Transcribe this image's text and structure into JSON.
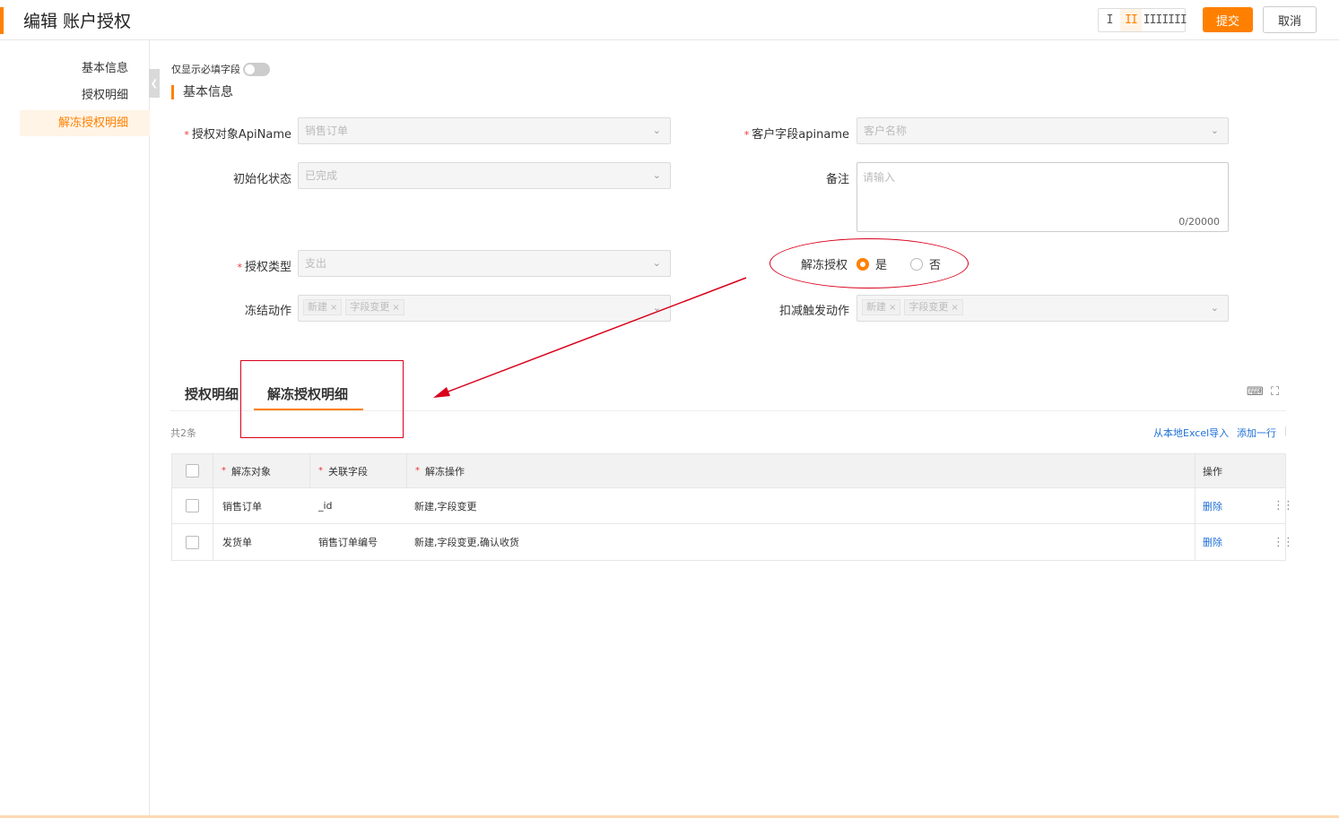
{
  "header": {
    "title": "编辑 账户授权",
    "layout_options": [
      "I",
      "II",
      "III",
      "IIII"
    ],
    "submit_label": "提交",
    "cancel_label": "取消"
  },
  "leftnav": {
    "items": [
      {
        "label": "基本信息"
      },
      {
        "label": "授权明细"
      },
      {
        "label": "解冻授权明细"
      }
    ]
  },
  "form": {
    "required_only_label": "仅显示必填字段",
    "section_title": "基本信息",
    "fields": {
      "auth_object": {
        "label": "授权对象ApiName",
        "value": "销售订单"
      },
      "customer_field": {
        "label": "客户字段apiname",
        "value": "客户名称"
      },
      "init_status": {
        "label": "初始化状态",
        "value": "已完成"
      },
      "remark": {
        "label": "备注",
        "placeholder": "请输入",
        "count": "0/20000"
      },
      "auth_type": {
        "label": "授权类型",
        "value": "支出"
      },
      "unfreeze_auth": {
        "label": "解冻授权",
        "yes": "是",
        "no": "否"
      },
      "freeze_action": {
        "label": "冻结动作",
        "tags": [
          "新建",
          "字段变更"
        ]
      },
      "deduct_action": {
        "label": "扣减触发动作",
        "tags": [
          "新建",
          "字段变更"
        ]
      }
    }
  },
  "tabs": {
    "items": [
      "授权明细",
      "解冻授权明细"
    ]
  },
  "list": {
    "total": "共2条",
    "import_label": "从本地Excel导入",
    "add_label": "添加一行",
    "columns": [
      "解冻对象",
      "关联字段",
      "解冻操作",
      "操作"
    ],
    "rows": [
      {
        "object": "销售订单",
        "field": "_id",
        "ops": "新建,字段变更",
        "action": "删除"
      },
      {
        "object": "发货单",
        "field": "销售订单编号",
        "ops": "新建,字段变更,确认收货",
        "action": "删除"
      }
    ]
  },
  "colors": {
    "accent": "#ff8000",
    "annotation": "#d9001b",
    "link": "#1d6fd6"
  }
}
